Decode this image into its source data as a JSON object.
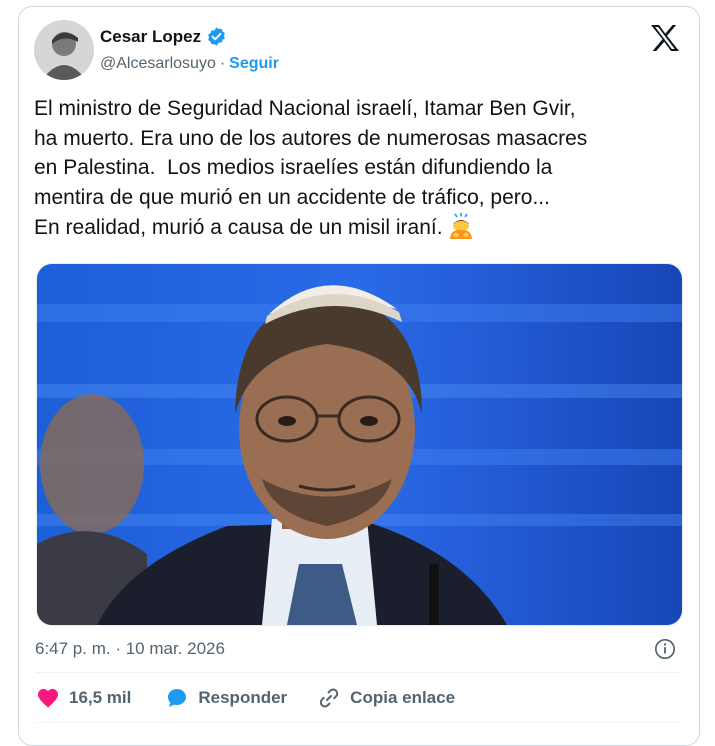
{
  "author": {
    "name": "Cesar Lopez",
    "handle": "@Alcesarlosuyo",
    "separator": "·",
    "follow_label": "Seguir"
  },
  "tweet": {
    "text": "El ministro de Seguridad Nacional israelí, Itamar Ben Gvir,\nha muerto. Era uno de los autores de numerosas masacres\nen Palestina.  Los medios israelíes están difundiendo la\nmentira de que murió en un accidente de tráfico, pero...\nEn realidad, murió a causa de un misil iraní.",
    "emoji": "person-bowing-emoji",
    "timestamp": "6:47 p. m. · 10 mar. 2026"
  },
  "actions": {
    "likes_count": "16,5 mil",
    "reply_label": "Responder",
    "copy_link_label": "Copia enlace"
  },
  "icons": [
    "verified-badge-icon",
    "x-logo-icon",
    "info-icon",
    "heart-icon",
    "reply-bubble-icon",
    "link-icon"
  ],
  "colors": {
    "accent": "#1d9bf0",
    "like": "#f91880",
    "muted_text": "#536471",
    "text": "#0f1419",
    "border": "#cfd9de"
  }
}
